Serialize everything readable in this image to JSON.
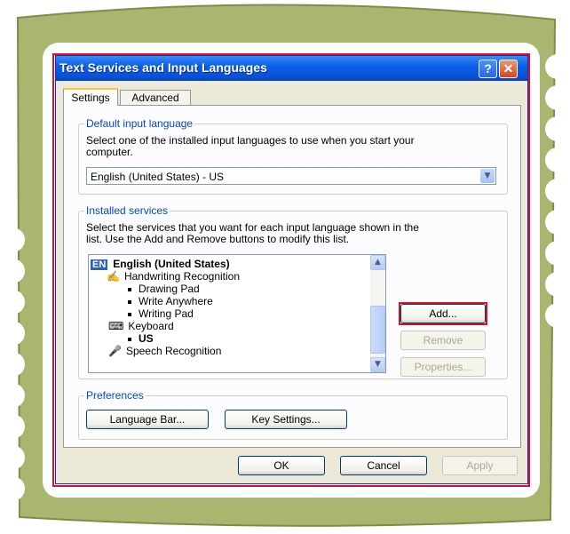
{
  "dialog": {
    "title": "Text Services and Input Languages",
    "help_glyph": "?",
    "close_glyph": "✕",
    "tabs": [
      {
        "label": "Settings"
      },
      {
        "label": "Advanced"
      }
    ]
  },
  "default_input": {
    "legend": "Default input language",
    "description_line1": "Select one of the installed input languages to use when you start your",
    "description_line2": "computer.",
    "selected": "English (United States) - US"
  },
  "installed_services": {
    "legend": "Installed services",
    "description_line1": "Select the services that you want for each input language shown in the",
    "description_line2": "list. Use the Add and Remove buttons to modify this list.",
    "items": [
      {
        "label": "English (United States)",
        "badge": "EN"
      },
      {
        "label": "Handwriting Recognition"
      },
      {
        "label": "Drawing Pad"
      },
      {
        "label": "Write Anywhere"
      },
      {
        "label": "Writing Pad"
      },
      {
        "label": "Keyboard"
      },
      {
        "label": "US"
      },
      {
        "label": "Speech Recognition"
      }
    ],
    "buttons": {
      "add": "Add...",
      "remove": "Remove",
      "properties": "Properties..."
    }
  },
  "preferences": {
    "legend": "Preferences",
    "language_bar": "Language Bar...",
    "key_settings": "Key Settings..."
  },
  "footer": {
    "ok": "OK",
    "cancel": "Cancel",
    "apply": "Apply"
  },
  "colors": {
    "frame_green": "#A8B66F",
    "title_blue": "#0A5FE8",
    "highlight_red": "#E0101A",
    "dialog_face": "#ECE9D8"
  }
}
